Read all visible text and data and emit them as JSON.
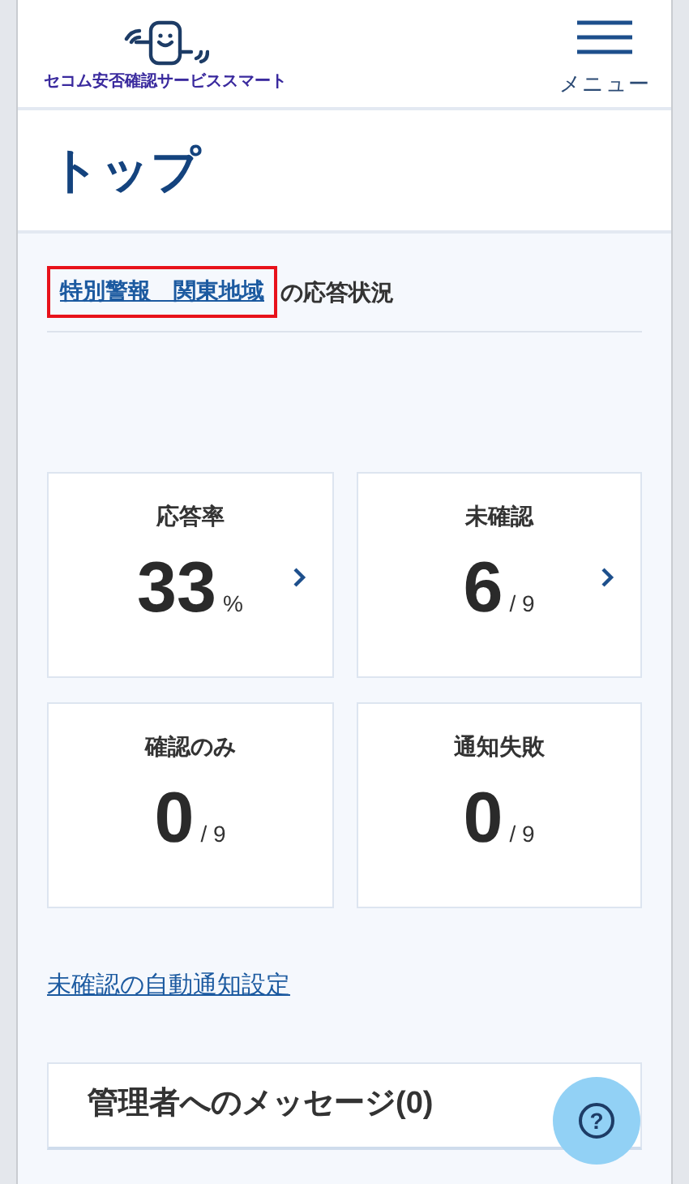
{
  "header": {
    "logo_text": "セコム安否確認サービススマート",
    "menu_label": "メニュー"
  },
  "page_title": "トップ",
  "status_heading": {
    "link": "特別警報　関東地域",
    "highlighted": true,
    "suffix": "の応答状況"
  },
  "stats": [
    {
      "label": "応答率",
      "value": "33",
      "unit": "%",
      "chevron": true
    },
    {
      "label": "未確認",
      "value": "6",
      "unit": "/ 9",
      "chevron": true
    },
    {
      "label": "確認のみ",
      "value": "0",
      "unit": "/ 9",
      "chevron": false
    },
    {
      "label": "通知失敗",
      "value": "0",
      "unit": "/ 9",
      "chevron": false
    }
  ],
  "auto_notify_link": "未確認の自動通知設定",
  "message_panel": {
    "title": "管理者へのメッセージ(0)"
  },
  "help_button": {
    "label": "?"
  }
}
